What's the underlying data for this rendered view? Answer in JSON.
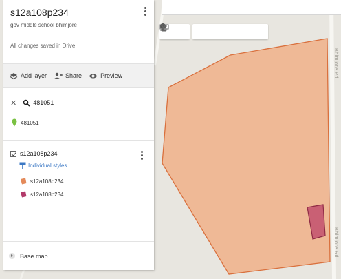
{
  "panel": {
    "title": "s12a108p234",
    "description": "gov middle school bhimjore",
    "save_status": "All changes saved in Drive",
    "actions": {
      "add_layer": "Add layer",
      "share": "Share",
      "preview": "Preview"
    },
    "search": {
      "term": "481051",
      "result_label": "481051"
    },
    "layer": {
      "name": "s12a108p234",
      "style_label": "Individual styles",
      "features": [
        {
          "label": "s12a108p234",
          "color": "#e48a5a"
        },
        {
          "label": "s12a108p234",
          "color": "#b23a6a"
        }
      ]
    },
    "base_map_label": "Base map"
  },
  "map": {
    "polygon_fill": "#f0b48e",
    "polygon_stroke": "#d9703d",
    "inner_fill": "#c96074",
    "inner_stroke": "#8f2b45",
    "road_label_top": "Bhimjore Rd",
    "road_label_bottom": "Bhimjore Rd"
  },
  "toolbar": {
    "tools": [
      "undo-icon",
      "redo-icon",
      "hand-icon",
      "marker-icon",
      "draw-line-icon",
      "route-icon",
      "ruler-icon"
    ]
  }
}
